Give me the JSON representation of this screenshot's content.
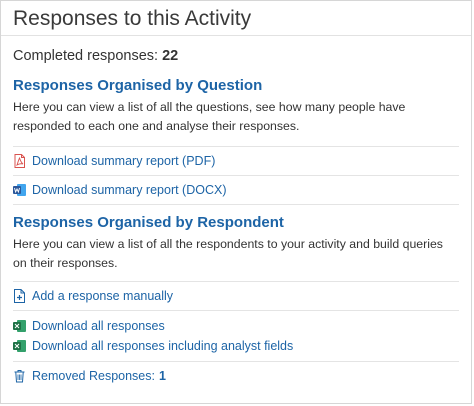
{
  "header": {
    "title": "Responses to this Activity"
  },
  "completed": {
    "label": "Completed responses:",
    "count": "22"
  },
  "by_question": {
    "title": "Responses Organised by Question",
    "description": "Here you can view a list of all the questions, see how many people have responded to each one and analyse their responses.",
    "links": [
      {
        "label": "Download summary report (PDF)",
        "icon": "pdf-icon"
      },
      {
        "label": "Download summary report (DOCX)",
        "icon": "word-icon"
      }
    ]
  },
  "by_respondent": {
    "title": "Responses Organised by Respondent",
    "description": "Here you can view a list of all the respondents to your activity and build queries on their responses.",
    "add_link": {
      "label": "Add a response manually",
      "icon": "add-file-icon"
    },
    "download_all": {
      "label": "Download all responses",
      "icon": "excel-icon"
    },
    "download_analyst": {
      "label": "Download all responses including analyst fields",
      "icon": "excel-icon"
    }
  },
  "removed": {
    "label": "Removed Responses:",
    "count": "1",
    "icon": "trash-icon"
  },
  "colors": {
    "link": "#1d64a6",
    "pdf": "#d9534f",
    "word": "#2b579a",
    "excel": "#1e7145"
  }
}
